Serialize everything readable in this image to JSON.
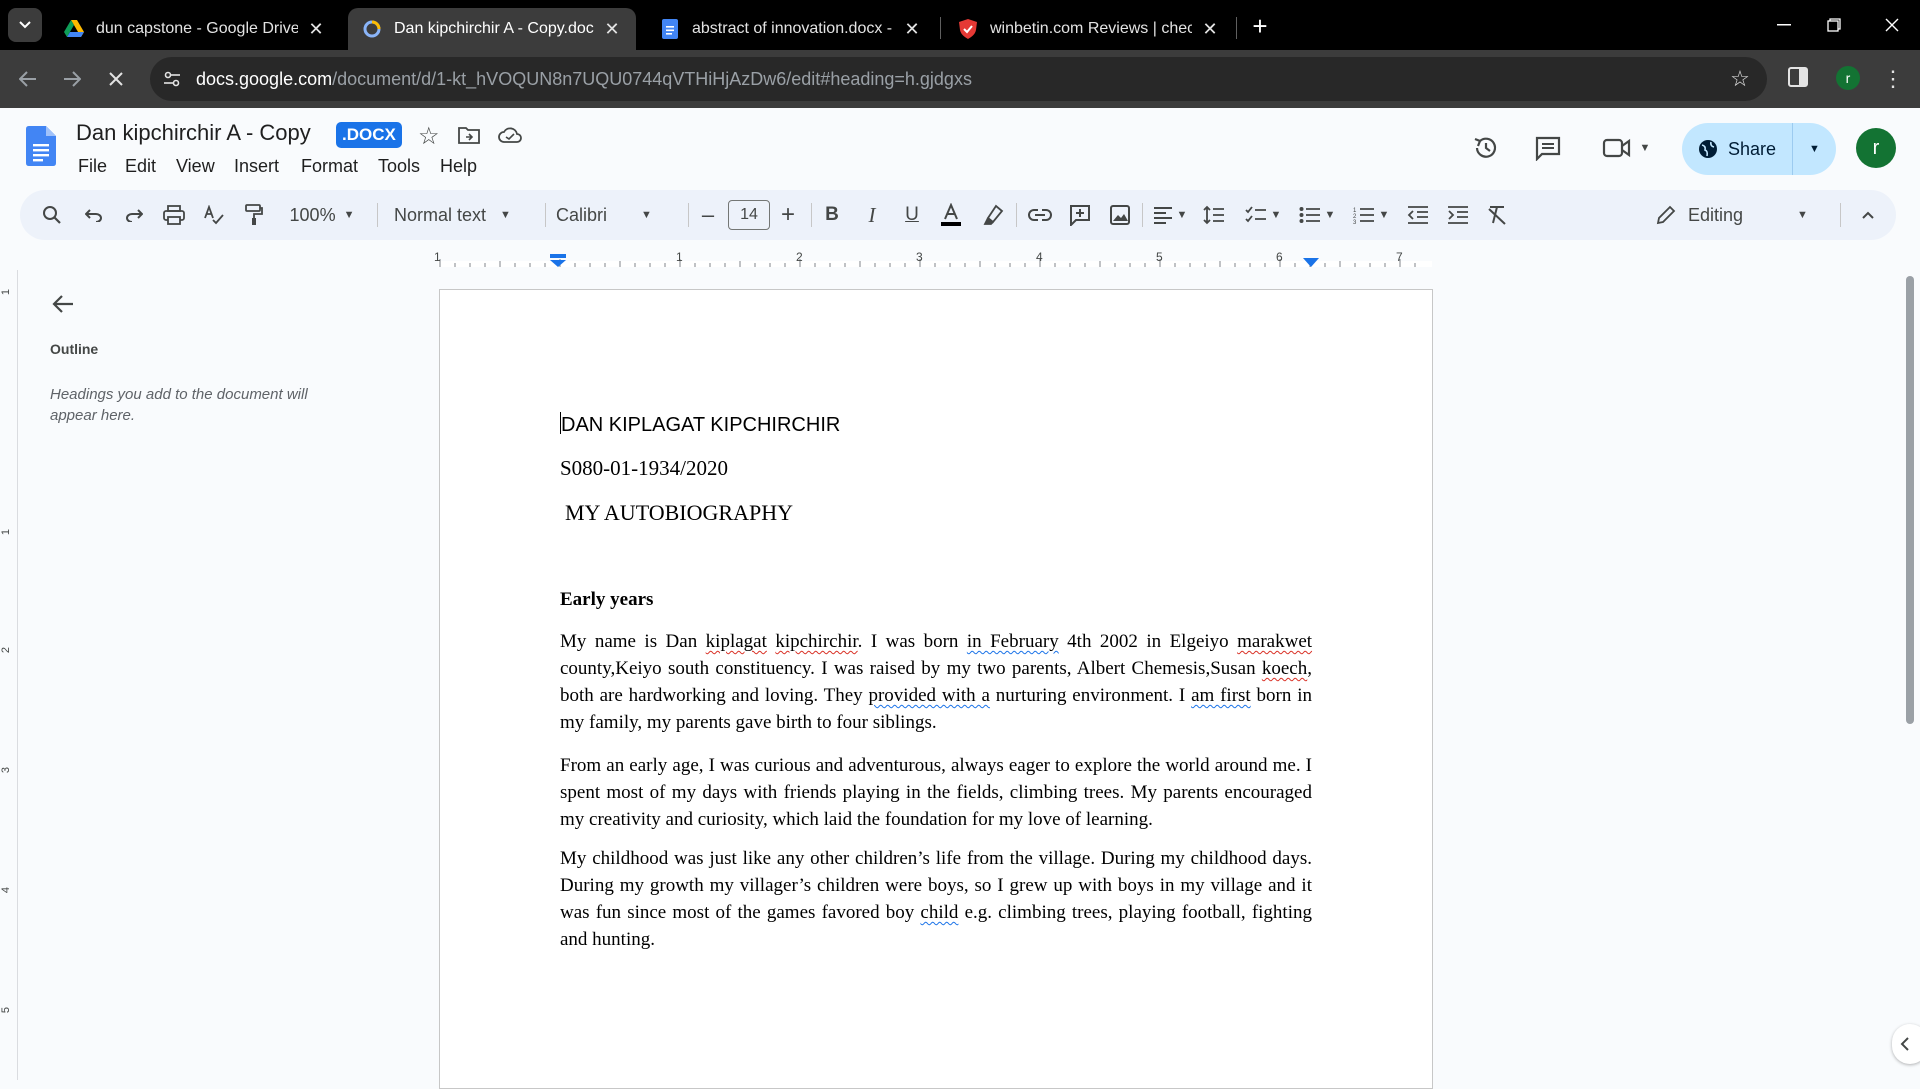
{
  "browser": {
    "tabs": [
      {
        "label": "dun capstone - Google Drive",
        "icon": "google-drive-icon"
      },
      {
        "label": "Dan kipchirchir A - Copy.docx - ",
        "icon": "loading-icon",
        "active": true
      },
      {
        "label": "abstract of innovation.docx - Go",
        "icon": "google-docs-icon"
      },
      {
        "label": "winbetin.com Reviews | check if",
        "icon": "shield-icon"
      }
    ],
    "url_host": "docs.google.com",
    "url_path": "/document/d/1-kt_hVOQUN8n7UQU0744qVTHiHjAzDw6/edit#heading=h.gjdgxs",
    "profile_initial": "r"
  },
  "doc": {
    "title": "Dan kipchirchir A - Copy",
    "badge": ".DOCX",
    "menu": [
      "File",
      "Edit",
      "View",
      "Insert",
      "Format",
      "Tools",
      "Help"
    ],
    "share_label": "Share",
    "avatar_initial": "r"
  },
  "format_toolbar": {
    "zoom": "100%",
    "style": "Normal text",
    "font": "Calibri",
    "font_size": "14",
    "mode": "Editing"
  },
  "ruler": {
    "marks": [
      "1",
      "1",
      "2",
      "3",
      "4",
      "5",
      "6",
      "7"
    ]
  },
  "left_ruler": {
    "marks": [
      "1",
      "1",
      "2",
      "3",
      "4",
      "5"
    ]
  },
  "outline": {
    "title": "Outline",
    "hint": "Headings you add to the document will appear here."
  },
  "content": {
    "name": "DAN KIPLAGAT KIPCHIRCHIR",
    "reg_no": "S080-01-1934/2020",
    "heading": "MY AUTOBIOGRAPHY",
    "section": "Early years",
    "p1": [
      {
        "t": "My name is Dan "
      },
      {
        "t": "kiplagat",
        "s": "sq"
      },
      {
        "t": " "
      },
      {
        "t": "kipchirchir",
        "s": "sq"
      },
      {
        "t": ". I was born "
      },
      {
        "t": "in February",
        "s": "bq"
      },
      {
        "t": " 4th 2002 in Elgeiyo "
      },
      {
        "t": "marakwet",
        "s": "sq"
      },
      {
        "t": " county,Keiyo south constituency. I was raised by my two parents, Albert Chemesis,Susan "
      },
      {
        "t": "koech",
        "s": "sq"
      },
      {
        "t": ", both are hardworking and loving. They "
      },
      {
        "t": "provided with a",
        "s": "bq"
      },
      {
        "t": " nurturing environment. I "
      },
      {
        "t": "am first",
        "s": "bq"
      },
      {
        "t": " born in my family, my parents gave birth to four siblings."
      }
    ],
    "p2": "From an early age, I was curious and adventurous, always eager to explore the world around me. I spent most of my days with friends playing in the fields, climbing trees. My parents encouraged my creativity and curiosity, which laid the foundation for my love of learning.",
    "p3": [
      {
        "t": "My childhood was just like any other children’s life from the village. During my childhood days. During my growth my villager’s children were boys, so I grew up with boys in my village and it was fun since most of the games favored boy "
      },
      {
        "t": "child",
        "s": "bq"
      },
      {
        "t": " e.g. climbing trees, playing football, fighting and hunting."
      }
    ]
  }
}
